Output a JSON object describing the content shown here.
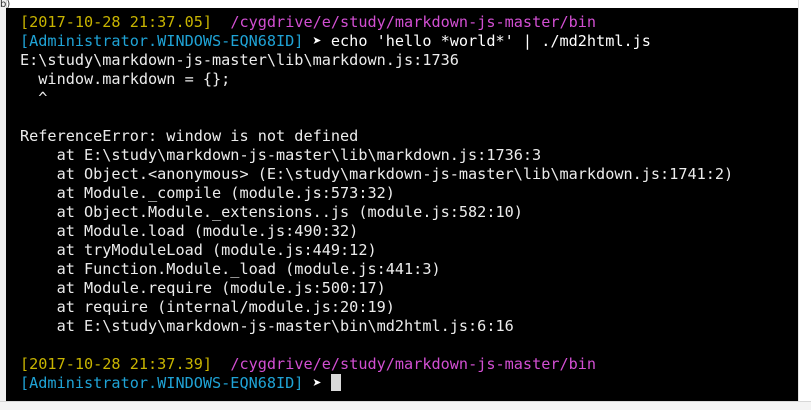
{
  "corner_fragment": "b)",
  "terminal": {
    "lines": [
      {
        "segments": [
          {
            "cls": "timestamp",
            "text": "[2017-10-28 21:37.05]"
          },
          {
            "cls": "out",
            "text": "  "
          },
          {
            "cls": "path",
            "text": "/cygdrive/e/study/markdown-js-master/bin"
          }
        ]
      },
      {
        "segments": [
          {
            "cls": "prompt-user",
            "text": "[Administrator.WINDOWS-EQN68ID]"
          },
          {
            "cls": "prompt-arrow",
            "text": " ➤ "
          },
          {
            "cls": "cmd",
            "text": "echo 'hello *world*' | ./md2html.js"
          }
        ]
      },
      {
        "segments": [
          {
            "cls": "out",
            "text": "E:\\study\\markdown-js-master\\lib\\markdown.js:1736"
          }
        ]
      },
      {
        "segments": [
          {
            "cls": "out",
            "text": "  window.markdown = {};"
          }
        ]
      },
      {
        "segments": [
          {
            "cls": "out",
            "text": "  ^"
          }
        ]
      },
      {
        "segments": [
          {
            "cls": "out",
            "text": ""
          }
        ]
      },
      {
        "segments": [
          {
            "cls": "out",
            "text": "ReferenceError: window is not defined"
          }
        ]
      },
      {
        "segments": [
          {
            "cls": "out",
            "text": "    at E:\\study\\markdown-js-master\\lib\\markdown.js:1736:3"
          }
        ]
      },
      {
        "segments": [
          {
            "cls": "out",
            "text": "    at Object.<anonymous> (E:\\study\\markdown-js-master\\lib\\markdown.js:1741:2)"
          }
        ]
      },
      {
        "segments": [
          {
            "cls": "out",
            "text": "    at Module._compile (module.js:573:32)"
          }
        ]
      },
      {
        "segments": [
          {
            "cls": "out",
            "text": "    at Object.Module._extensions..js (module.js:582:10)"
          }
        ]
      },
      {
        "segments": [
          {
            "cls": "out",
            "text": "    at Module.load (module.js:490:32)"
          }
        ]
      },
      {
        "segments": [
          {
            "cls": "out",
            "text": "    at tryModuleLoad (module.js:449:12)"
          }
        ]
      },
      {
        "segments": [
          {
            "cls": "out",
            "text": "    at Function.Module._load (module.js:441:3)"
          }
        ]
      },
      {
        "segments": [
          {
            "cls": "out",
            "text": "    at Module.require (module.js:500:17)"
          }
        ]
      },
      {
        "segments": [
          {
            "cls": "out",
            "text": "    at require (internal/module.js:20:19)"
          }
        ]
      },
      {
        "segments": [
          {
            "cls": "out",
            "text": "    at E:\\study\\markdown-js-master\\bin\\md2html.js:6:16"
          }
        ]
      },
      {
        "segments": [
          {
            "cls": "out",
            "text": ""
          }
        ]
      },
      {
        "segments": [
          {
            "cls": "timestamp",
            "text": "[2017-10-28 21:37.39]"
          },
          {
            "cls": "out",
            "text": "  "
          },
          {
            "cls": "path",
            "text": "/cygdrive/e/study/markdown-js-master/bin"
          }
        ]
      },
      {
        "segments": [
          {
            "cls": "prompt-user",
            "text": "[Administrator.WINDOWS-EQN68ID]"
          },
          {
            "cls": "prompt-arrow",
            "text": " ➤ "
          }
        ],
        "cursor": true
      }
    ]
  }
}
